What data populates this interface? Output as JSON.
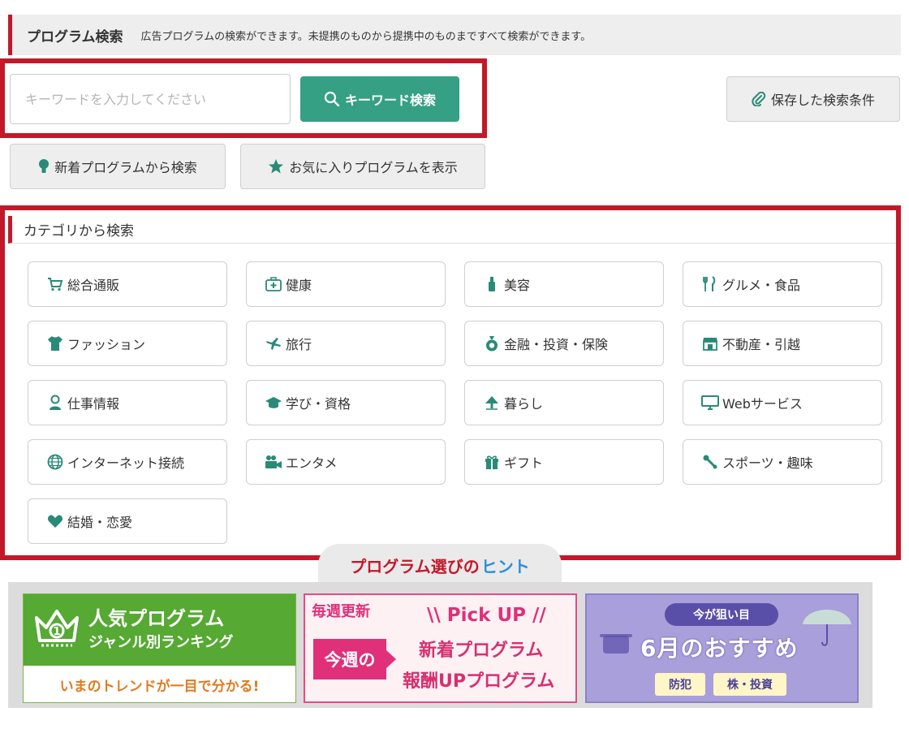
{
  "header": {
    "title": "プログラム検索",
    "description": "広告プログラムの検索ができます。未提携のものから提携中のものまですべて検索ができます。"
  },
  "search": {
    "placeholder": "キーワードを入力してください",
    "value": "",
    "button_label": "キーワード検索"
  },
  "saved_conditions_label": "保存した検索条件",
  "new_programs_label": "新着プログラムから検索",
  "favorites_label": "お気に入りプログラムを表示",
  "category": {
    "title": "カテゴリから検索",
    "items": [
      {
        "label": "総合通販",
        "icon": "cart-icon"
      },
      {
        "label": "健康",
        "icon": "first-aid-icon"
      },
      {
        "label": "美容",
        "icon": "cosmetics-icon"
      },
      {
        "label": "グルメ・食品",
        "icon": "fork-knife-icon"
      },
      {
        "label": "ファッション",
        "icon": "shirt-icon"
      },
      {
        "label": "旅行",
        "icon": "airplane-icon"
      },
      {
        "label": "金融・投資・保険",
        "icon": "money-bag-icon"
      },
      {
        "label": "不動産・引越",
        "icon": "shop-icon"
      },
      {
        "label": "仕事情報",
        "icon": "person-icon"
      },
      {
        "label": "学び・資格",
        "icon": "graduation-cap-icon"
      },
      {
        "label": "暮らし",
        "icon": "house-plant-icon"
      },
      {
        "label": "Webサービス",
        "icon": "monitor-icon"
      },
      {
        "label": "インターネット接続",
        "icon": "globe-icon"
      },
      {
        "label": "エンタメ",
        "icon": "video-camera-icon"
      },
      {
        "label": "ギフト",
        "icon": "gift-icon"
      },
      {
        "label": "スポーツ・趣味",
        "icon": "tools-icon"
      },
      {
        "label": "結婚・恋愛",
        "icon": "heart-icon"
      }
    ]
  },
  "tips": {
    "title": "プログラム選びの",
    "title_hint": "ヒント"
  },
  "banners": {
    "ranking": {
      "line1": "人気プログラム",
      "line2": "ジャンル別ランキング",
      "tagline": "いまのトレンドが一目で分かる!"
    },
    "weekly": {
      "badge": "毎週更新",
      "pickup": "\\\\ Pick UP //",
      "this_week": "今週の",
      "new_programs": "新着プログラム",
      "reward_up": "報酬UPプログラム"
    },
    "monthly": {
      "pill": "今が狙い目",
      "headline": "6月のおすすめ",
      "tags": [
        "防犯",
        "株・投資"
      ]
    }
  },
  "colors": {
    "accent_red": "#c2192a",
    "primary_green": "#35a083",
    "icon_teal": "#2a8a78"
  }
}
